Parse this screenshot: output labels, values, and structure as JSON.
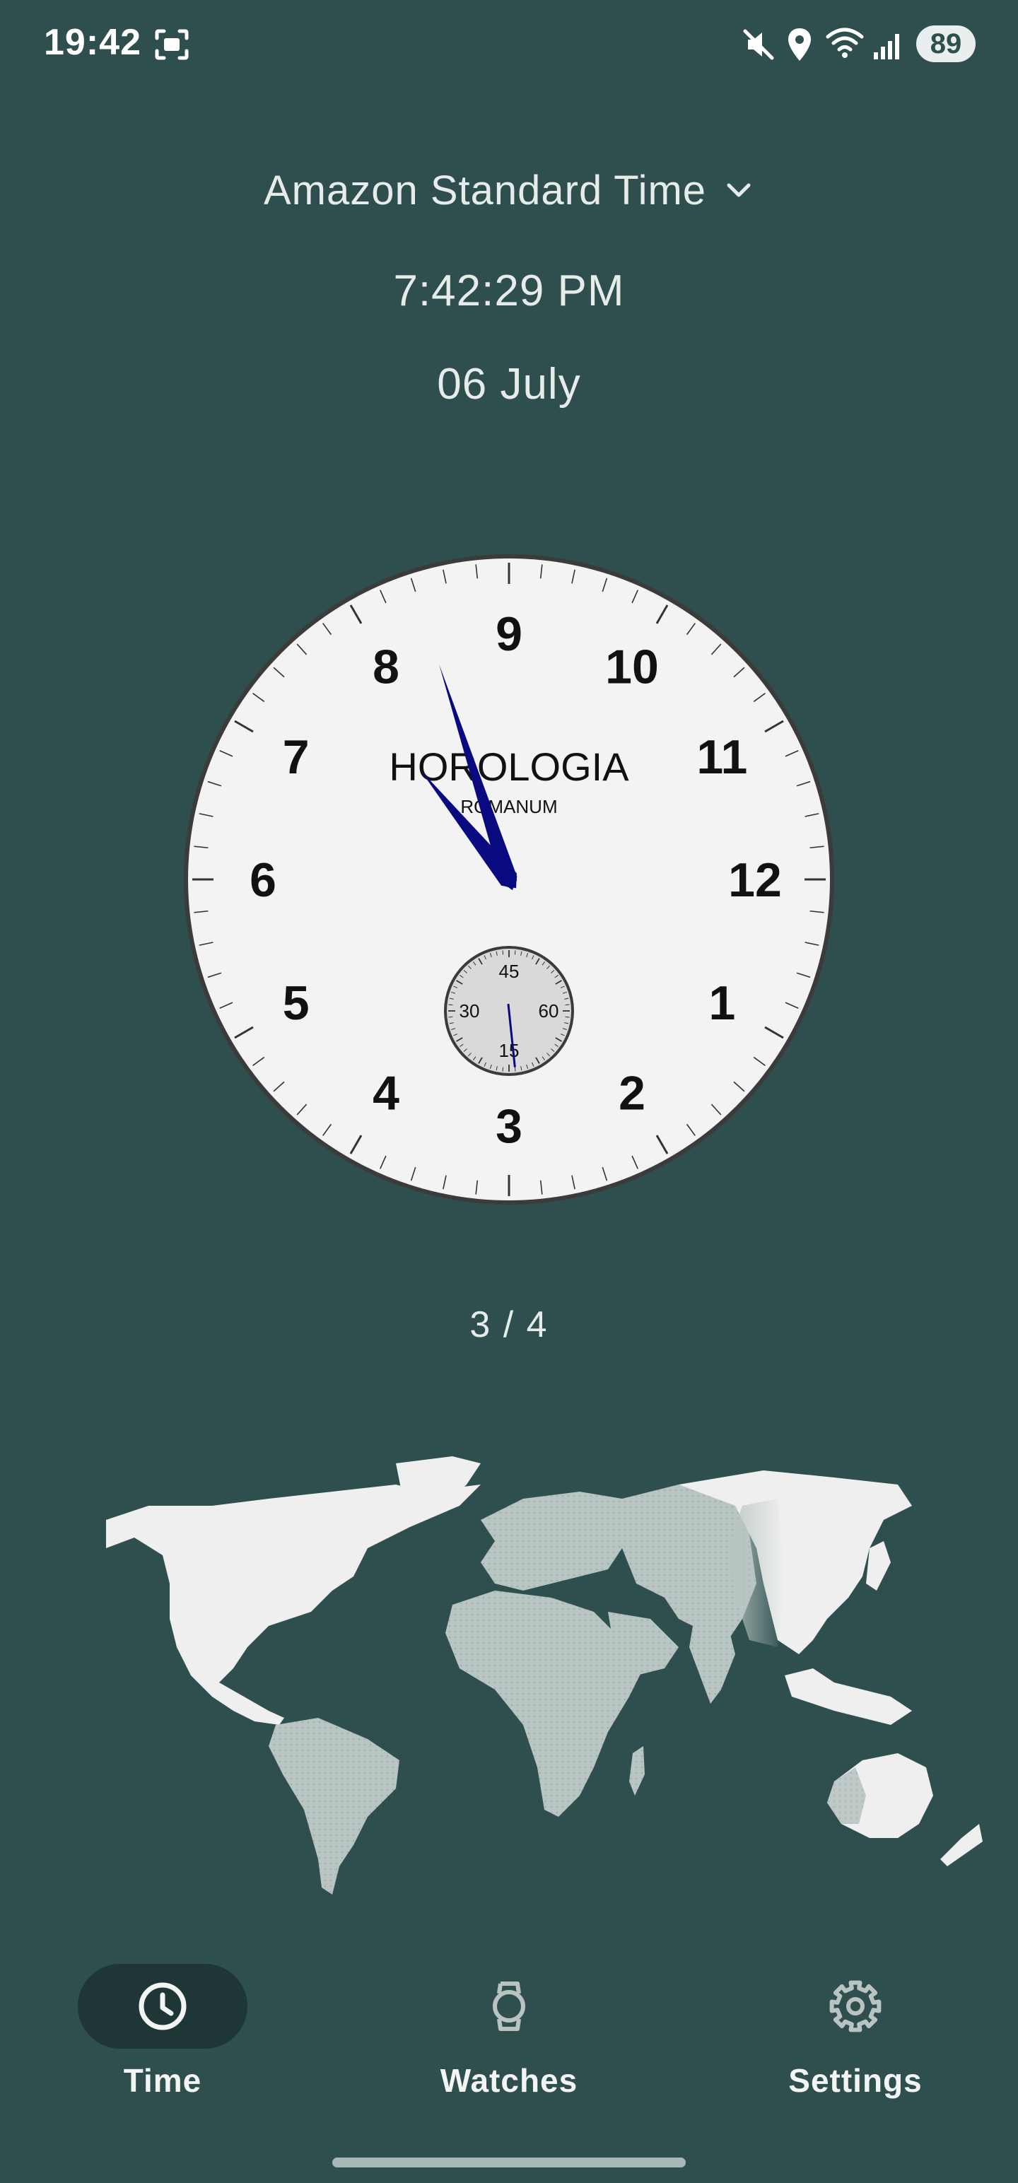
{
  "status_bar": {
    "time": "19:42",
    "battery": "89",
    "icons": [
      "screenshot-icon",
      "mute-icon",
      "location-icon",
      "wifi-icon",
      "signal-icon"
    ]
  },
  "timezone": {
    "label": "Amazon Standard Time",
    "icon": "chevron-down-icon"
  },
  "clock": {
    "time": "7:42:29 PM",
    "date": "06 July"
  },
  "watch": {
    "brand": "HOROLOGIA",
    "model": "ROMANUM",
    "dial_numbers": [
      "12",
      "1",
      "2",
      "3",
      "4",
      "5",
      "6",
      "7",
      "8",
      "9",
      "10",
      "11"
    ],
    "subdial_numbers": [
      "60",
      "15",
      "30",
      "45"
    ],
    "hour_value": 7.7,
    "minute_value": 42,
    "second_value": 29,
    "colors": {
      "dial": "#f3f3f3",
      "hands": "#0a0a80",
      "bezel": "#3b3b3b",
      "subdial": "#d9d9d9"
    }
  },
  "pager": {
    "text": "3 / 4"
  },
  "map": {
    "land_color": "#efefef",
    "night_color": "#b8c5c3"
  },
  "nav": {
    "items": [
      {
        "label": "Time",
        "icon": "clock-icon",
        "active": true
      },
      {
        "label": "Watches",
        "icon": "watch-icon",
        "active": false
      },
      {
        "label": "Settings",
        "icon": "gear-icon",
        "active": false
      }
    ]
  },
  "colors": {
    "background": "#2f4f4e",
    "text": "#e6ecea",
    "nav_active": "#1e3736"
  }
}
